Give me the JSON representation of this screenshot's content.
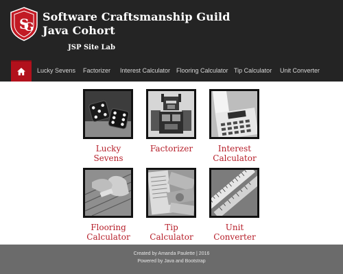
{
  "header": {
    "title_line1": "Software Craftsmanship Guild",
    "title_line2": "Java Cohort",
    "subtitle": "JSP Site Lab",
    "logo_letters": "SG"
  },
  "colors": {
    "accent": "#b2111c",
    "tile_label": "#b51c27",
    "header_bg": "#242424",
    "footer_bg": "#6b6b6b"
  },
  "nav": {
    "home_icon": "home-icon",
    "items": [
      {
        "label": "Lucky Sevens"
      },
      {
        "label": "Factorizer"
      },
      {
        "label": "Interest Calculator"
      },
      {
        "label": "Flooring Calculator"
      },
      {
        "label": "Tip Calculator"
      },
      {
        "label": "Unit Converter"
      }
    ]
  },
  "tiles": [
    {
      "line1": "Lucky",
      "line2": "Sevens",
      "image": "dice-image"
    },
    {
      "line1": "Factorizer",
      "line2": "",
      "image": "robot-image"
    },
    {
      "line1": "Interest",
      "line2": "Calculator",
      "image": "adding-machine-image"
    },
    {
      "line1": "Flooring",
      "line2": "Calculator",
      "image": "floor-planks-image"
    },
    {
      "line1": "Tip",
      "line2": "Calculator",
      "image": "receipt-money-image"
    },
    {
      "line1": "Unit",
      "line2": "Converter",
      "image": "rulers-image"
    }
  ],
  "footer": {
    "line1": "Created by Amanda Paulette | 2016",
    "line2": "Powered by Java and Bootstrap"
  }
}
